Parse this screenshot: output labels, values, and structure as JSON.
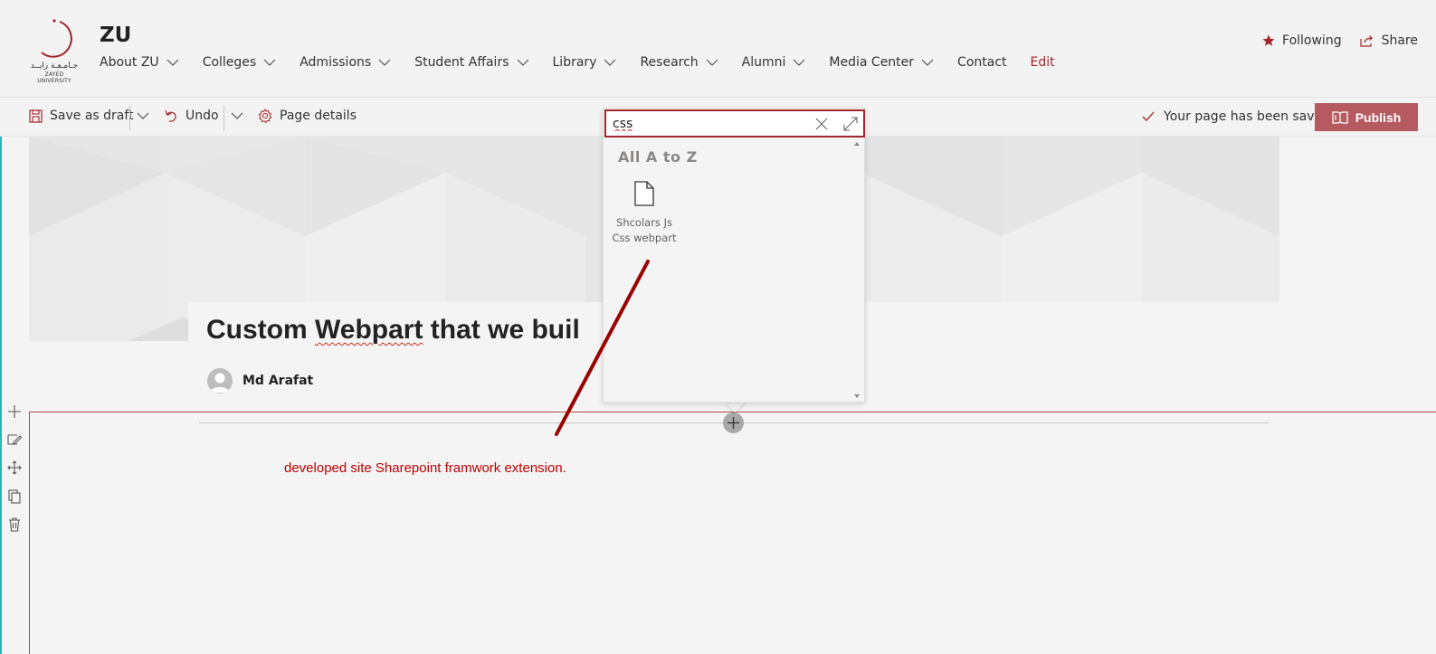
{
  "site": {
    "title": "ZU",
    "logo_arabic": "جـامـعـة زايــد",
    "logo_english": "ZAYED UNIVERSITY"
  },
  "nav": {
    "items": [
      {
        "label": "About ZU",
        "has_dropdown": true
      },
      {
        "label": "Colleges",
        "has_dropdown": true
      },
      {
        "label": "Admissions",
        "has_dropdown": true
      },
      {
        "label": "Student Affairs",
        "has_dropdown": true
      },
      {
        "label": "Library",
        "has_dropdown": true
      },
      {
        "label": "Research",
        "has_dropdown": true
      },
      {
        "label": "Alumni",
        "has_dropdown": true
      },
      {
        "label": "Media Center",
        "has_dropdown": true
      },
      {
        "label": "Contact",
        "has_dropdown": false
      }
    ],
    "edit_label": "Edit"
  },
  "header_actions": {
    "following_label": "Following",
    "share_label": "Share"
  },
  "command_bar": {
    "save_draft_label": "Save as draft",
    "undo_label": "Undo",
    "page_details_label": "Page details",
    "saved_status": "Your page has been saved",
    "publish_label": "Publish"
  },
  "toolbox": {
    "search_value": "css",
    "heading": "All A to Z",
    "items": [
      {
        "label_line1": "Shcolars Js",
        "label_line2": "Css webpart",
        "icon": "page-icon"
      }
    ]
  },
  "page": {
    "title_part1": "Custom ",
    "title_part2": "Webpart",
    "title_part3": " that we buil",
    "author": "Md Arafat",
    "section_text": "developed site Sharepoint framwork extension."
  },
  "colors": {
    "accent": "#a4262c",
    "publish": "#b55a5f",
    "annotation": "#c00000"
  }
}
